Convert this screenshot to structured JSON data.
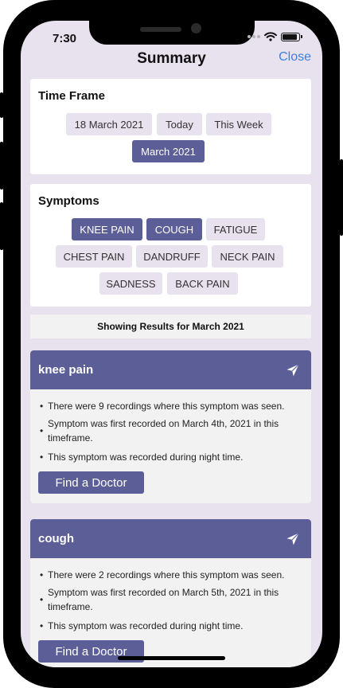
{
  "status_bar": {
    "time": "7:30"
  },
  "nav": {
    "title": "Summary",
    "close_label": "Close"
  },
  "time_frame": {
    "title": "Time Frame",
    "options": [
      "18 March 2021",
      "Today",
      "This Week",
      "March 2021"
    ],
    "selected": "March 2021"
  },
  "symptoms_filter": {
    "title": "Symptoms",
    "options": [
      "KNEE PAIN",
      "COUGH",
      "FATIGUE",
      "CHEST PAIN",
      "DANDRUFF",
      "NECK PAIN",
      "SADNESS",
      "BACK PAIN"
    ],
    "selected": [
      "KNEE PAIN",
      "COUGH"
    ]
  },
  "results_header": "Showing Results for March 2021",
  "results": [
    {
      "symptom": "knee pain",
      "bullets": [
        "There were 9 recordings where this symptom was seen.",
        "Symptom was first recorded on March 4th, 2021 in this timeframe.",
        "This symptom was recorded during night time."
      ],
      "button_label": "Find a Doctor"
    },
    {
      "symptom": "cough",
      "bullets": [
        "There were 2 recordings where this symptom was seen.",
        "Symptom was first recorded on March 5th, 2021 in this timeframe.",
        "This symptom was recorded during night time."
      ],
      "button_label": "Find a Doctor"
    }
  ],
  "icons": {
    "header_action": "send-arrow-icon",
    "status": [
      "signal-icon",
      "wifi-icon",
      "battery-icon"
    ]
  },
  "colors": {
    "accent": "#5c5e98",
    "chip": "#e8e1ee",
    "screen_bg": "#e8e1ee",
    "close_link": "#3b82e0"
  }
}
